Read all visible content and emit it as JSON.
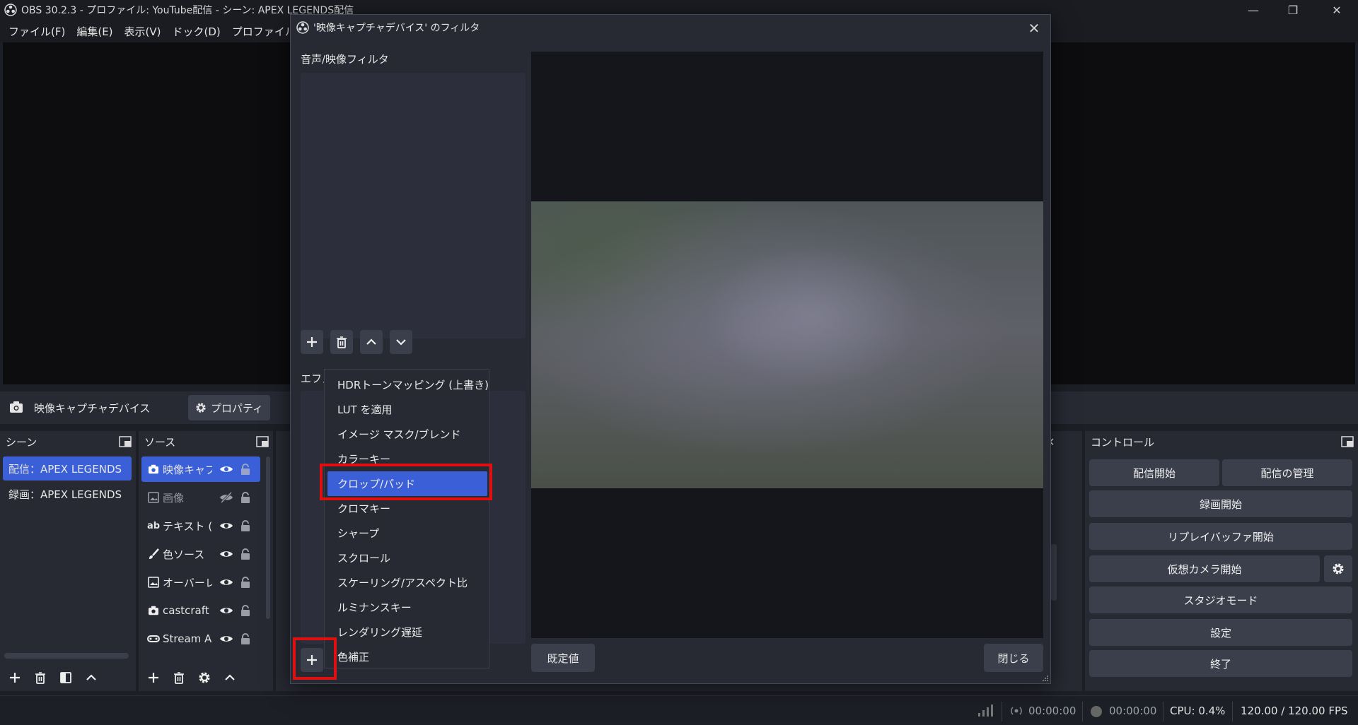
{
  "window": {
    "title": "OBS 30.2.3 - プロファイル: YouTube配信 - シーン: APEX LEGENDS配信",
    "minimize": "—",
    "restore": "❐",
    "close": "✕"
  },
  "menubar": [
    "ファイル(F)",
    "編集(E)",
    "表示(V)",
    "ドック(D)",
    "プロファイル(P)"
  ],
  "source_toolbar": {
    "source_name": "映像キャプチャデバイス",
    "properties_label": "プロパティ"
  },
  "scenes": {
    "title": "シーン",
    "items": [
      "配信：APEX LEGENDS",
      "録画：APEX LEGENDS"
    ]
  },
  "sources": {
    "title": "ソース",
    "items": [
      {
        "name": "映像キャプ",
        "icon": "camera-icon",
        "visible": true
      },
      {
        "name": "画像",
        "icon": "image-icon",
        "visible": false
      },
      {
        "name": "テキスト (C",
        "icon": "text-icon",
        "visible": true
      },
      {
        "name": "色ソース",
        "icon": "brush-icon",
        "visible": true
      },
      {
        "name": "オーバーレ",
        "icon": "image-icon",
        "visible": true
      },
      {
        "name": "castcraft",
        "icon": "camera-icon",
        "visible": true
      },
      {
        "name": "Stream A",
        "icon": "gamepad-icon",
        "visible": true
      }
    ]
  },
  "controls": {
    "title": "コントロール",
    "start_stream": "配信開始",
    "manage_stream": "配信の管理",
    "start_recording": "録画開始",
    "start_replay": "リプレイバッファ開始",
    "start_virtualcam": "仮想カメラ開始",
    "studio_mode": "スタジオモード",
    "settings": "設定",
    "exit": "終了"
  },
  "statusbar": {
    "stream_time": "00:00:00",
    "record_time": "00:00:00",
    "cpu": "CPU: 0.4%",
    "fps": "120.00 / 120.00 FPS"
  },
  "dialog": {
    "title": "'映像キャプチャデバイス' のフィルタ",
    "av_filters_label": "音声/映像フィルタ",
    "effect_filters_label": "エフェクトフィルタ",
    "default_button": "既定値",
    "close_button": "閉じる"
  },
  "filter_menu": {
    "items": [
      "HDRトーンマッピング (上書き)",
      "LUT を適用",
      "イメージ マスク/ブレンド",
      "カラーキー",
      "クロップ/パッド",
      "クロマキー",
      "シャープ",
      "スクロール",
      "スケーリング/アスペクト比",
      "ルミナンスキー",
      "レンダリング遅延",
      "色補正"
    ],
    "selected": "クロップ/パッド"
  },
  "colors": {
    "accent": "#3a5fd6",
    "highlight": "#e01010",
    "panel": "#272a33",
    "background": "#1d1f26"
  }
}
